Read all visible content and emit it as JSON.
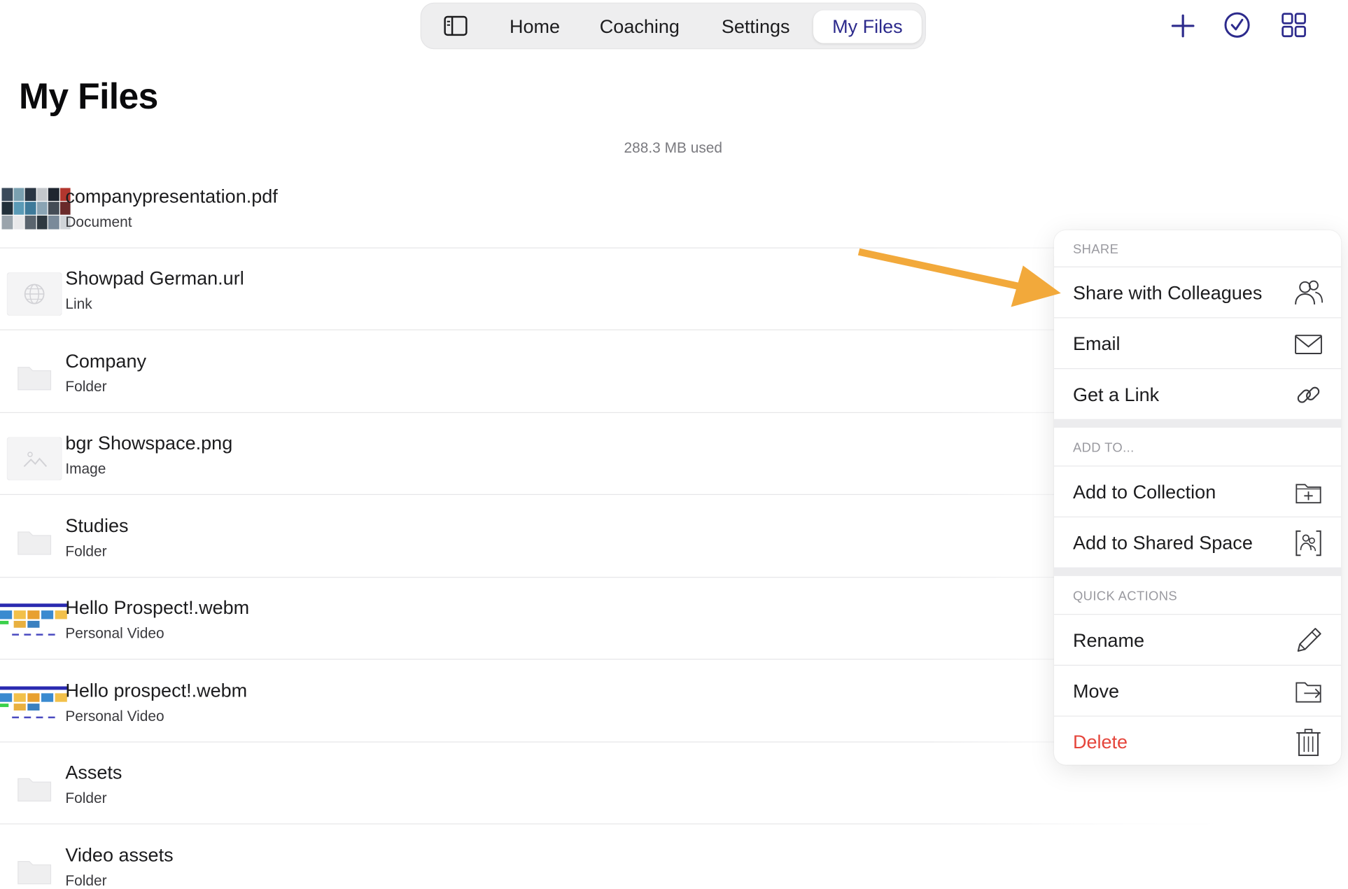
{
  "nav": {
    "items": [
      {
        "label": "Home"
      },
      {
        "label": "Coaching"
      },
      {
        "label": "Settings"
      },
      {
        "label": "My Files",
        "active": true
      }
    ],
    "icons": [
      "sidebar-toggle-icon",
      "plus-icon",
      "check-circle-icon",
      "grid-icon"
    ]
  },
  "page": {
    "title": "My Files",
    "usage": "288.3 MB used"
  },
  "files": [
    {
      "name": "companypresentation.pdf",
      "type": "Document",
      "thumb": "photo-collage",
      "more_icon": "ooo"
    },
    {
      "name": "Showpad German.url",
      "type": "Link",
      "thumb": "globe-icon"
    },
    {
      "name": "Company",
      "type": "Folder",
      "thumb": "folder-icon"
    },
    {
      "name": "bgr Showspace.png",
      "type": "Image",
      "thumb": "image-icon"
    },
    {
      "name": "Studies",
      "type": "Folder",
      "thumb": "folder-icon"
    },
    {
      "name": "Hello Prospect!.webm",
      "type": "Personal Video",
      "thumb": "video-preview"
    },
    {
      "name": "Hello prospect!.webm",
      "type": "Personal Video",
      "thumb": "video-preview"
    },
    {
      "name": "Assets",
      "type": "Folder",
      "thumb": "folder-icon",
      "more_icon": "ooo"
    },
    {
      "name": "Video assets",
      "type": "Folder",
      "thumb": "folder-icon",
      "more_icon": "ooo"
    }
  ],
  "menu": {
    "share_label": "SHARE",
    "add_label": "ADD TO...",
    "quick_label": "QUICK ACTIONS",
    "share_items": [
      {
        "label": "Share with Colleagues",
        "icon": "colleagues-icon"
      },
      {
        "label": "Email",
        "icon": "envelope-icon"
      },
      {
        "label": "Get a Link",
        "icon": "link-icon"
      }
    ],
    "add_items": [
      {
        "label": "Add to Collection",
        "icon": "folder-plus-icon"
      },
      {
        "label": "Add to Shared Space",
        "icon": "shared-space-icon"
      }
    ],
    "quick_items": [
      {
        "label": "Rename",
        "icon": "pencil-icon"
      },
      {
        "label": "Move",
        "icon": "folder-move-icon"
      },
      {
        "label": "Delete",
        "icon": "trash-icon",
        "color": "#e5453b"
      }
    ]
  },
  "colors": {
    "accent": "#2c2a8c",
    "highlight": "#f2a93b",
    "danger": "#e5453b"
  }
}
